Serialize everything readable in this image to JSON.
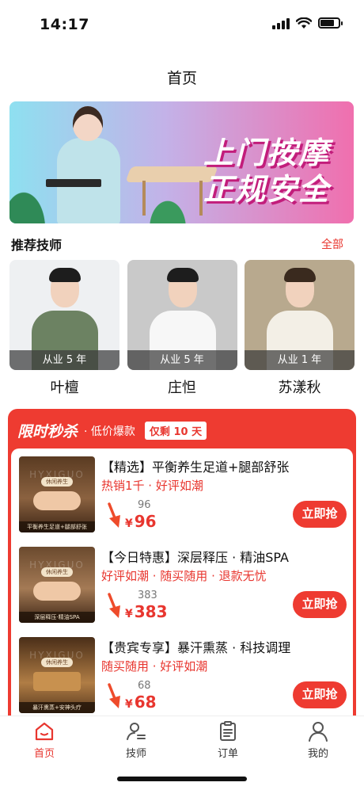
{
  "status_bar": {
    "time": "14:17",
    "battery_level": 0.75
  },
  "header": {
    "title": "首页"
  },
  "banner": {
    "line1": "上门按摩",
    "line2": "正规安全"
  },
  "technicians": {
    "title": "推荐技师",
    "more_label": "全部",
    "items": [
      {
        "name": "叶檀",
        "experience": "从业 5 年",
        "shirt_color": "#6c8262",
        "bg_color": "#eef0f2"
      },
      {
        "name": "庄怛",
        "experience": "从业 5 年",
        "shirt_color": "#f7f7f7",
        "bg_color": "#c9c9c9"
      },
      {
        "name": "苏漾秋",
        "experience": "从业 1 年",
        "shirt_color": "#f3efe6",
        "bg_color": "#b8a98e"
      }
    ]
  },
  "flash_sale": {
    "title": "限时秒杀",
    "subtitle": "· 低价爆款",
    "badge": "仅剩 10 天",
    "products": [
      {
        "title": "【精选】平衡养生足道+腿部舒张",
        "tags": "热销1千 · 好评如潮",
        "old_price": "96",
        "currency": "¥",
        "price": "96",
        "button": "立即抢",
        "thumb_label": "休闲养生",
        "thumb_caption": "平衡养生足道+腿部舒张",
        "thumb_watermark": "HYXIGUO"
      },
      {
        "title": "【今日特惠】深层释压 · 精油SPA",
        "tags": "好评如潮 · 随买随用 · 退款无忧",
        "old_price": "383",
        "currency": "¥",
        "price": "383",
        "button": "立即抢",
        "thumb_label": "休闲养生",
        "thumb_caption": "深层释压·精油SPA",
        "thumb_watermark": "HYXIGUO"
      },
      {
        "title": "【贵宾专享】暴汗熏蒸 · 科技调理",
        "tags": "随买随用 · 好评如潮",
        "old_price": "68",
        "currency": "¥",
        "price": "68",
        "button": "立即抢",
        "thumb_label": "休闲养生",
        "thumb_caption": "暴汗熏蒸+安神头疗",
        "thumb_watermark": "HYXIGUO"
      }
    ]
  },
  "tabbar": {
    "items": [
      {
        "label": "首页",
        "icon": "home-icon",
        "active": true
      },
      {
        "label": "技师",
        "icon": "technician-icon",
        "active": false
      },
      {
        "label": "订单",
        "icon": "order-icon",
        "active": false
      },
      {
        "label": "我的",
        "icon": "profile-icon",
        "active": false
      }
    ],
    "accent": "#e8362f"
  }
}
